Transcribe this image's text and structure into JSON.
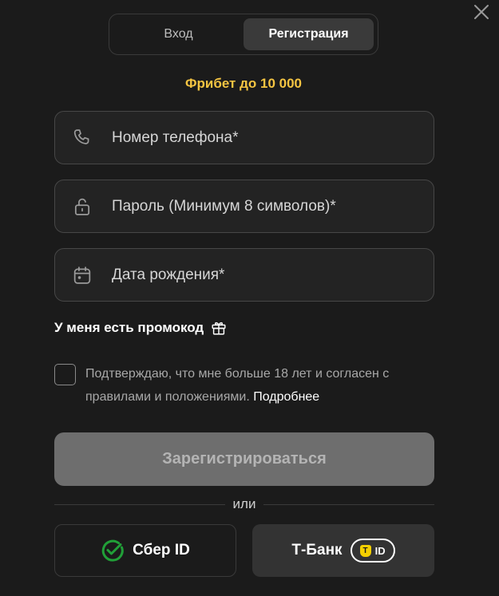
{
  "tabs": [
    {
      "label": "Вход",
      "active": false
    },
    {
      "label": "Регистрация",
      "active": true
    }
  ],
  "bonus": {
    "text": "Фрибет до 10 000",
    "color": "#f5c542"
  },
  "fields": {
    "phone": {
      "placeholder": "Номер телефона*",
      "icon": "phone-icon"
    },
    "password": {
      "placeholder": "Пароль (Минимум 8 символов)*",
      "icon": "lock-icon"
    },
    "birthdate": {
      "placeholder": "Дата рождения*",
      "icon": "calendar-icon"
    }
  },
  "promo": {
    "label": "У меня есть промокод",
    "icon": "gift-icon"
  },
  "agreement": {
    "text": "Подтверждаю, что мне больше 18 лет и согласен с правилами и положениями.",
    "link": "Подробнее",
    "checked": false
  },
  "submit": {
    "label": "Зарегистрироваться"
  },
  "divider": {
    "label": "или"
  },
  "social": {
    "sber": {
      "label": "Сбер ID",
      "icon": "sber-logo-icon",
      "color": "#21a038"
    },
    "tbank": {
      "label": "Т-Банк",
      "badge_letter": "Т",
      "badge_text": "ID",
      "icon": "tbank-id-logo-icon",
      "color": "#f5d000"
    }
  },
  "close": {
    "icon": "close-icon"
  }
}
